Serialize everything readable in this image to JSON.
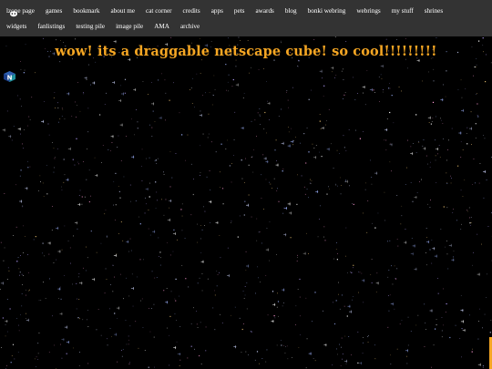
{
  "nav": {
    "row1": [
      "lzone page",
      "games",
      "bookmark",
      "about me",
      "cat corner",
      "credits",
      "apps",
      "pets",
      "awards",
      "blog",
      "bonki webring",
      "webrings",
      "my stuff",
      "shrines"
    ],
    "row2": [
      "widgets",
      "fanlistings",
      "testing pile",
      "image pile",
      "AMA",
      "archive"
    ]
  },
  "heading": "wow! its a draggable netscape cube! so cool!!!!!!!!!",
  "cube": {
    "letter": "N"
  },
  "colors": {
    "navbar_bg": "#333333",
    "nav_text": "#ffffff",
    "heading": "#f5a623",
    "background": "#000000",
    "cube_blue": "#1c3f8a",
    "cube_teal": "#1f8f9c"
  }
}
